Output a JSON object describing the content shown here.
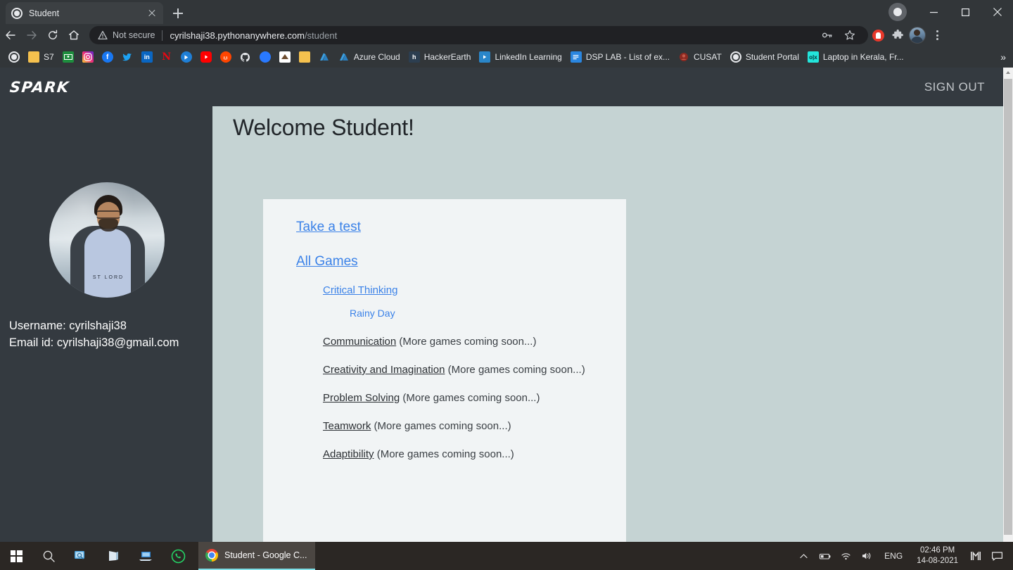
{
  "browser": {
    "tab": {
      "title": "Student",
      "favicon": "globe-icon"
    },
    "new_tab_label": "+",
    "omnibox": {
      "security_label": "Not secure",
      "url_host": "cyrilshaji38.pythonanywhere.com",
      "url_path": "/student"
    },
    "toolbar_icons": [
      "back-icon",
      "forward-icon",
      "reload-icon",
      "home-icon",
      "key-icon",
      "star-icon",
      "adblock-shield-icon",
      "extensions-puzzle-icon",
      "profile-avatar-icon",
      "three-dot-menu-icon"
    ],
    "window_controls": [
      "record-indicator",
      "minimize",
      "maximize",
      "close"
    ],
    "bookmarks": [
      {
        "label": "",
        "icon": "globe-icon"
      },
      {
        "label": "S7",
        "icon": "folder-icon"
      },
      {
        "label": "",
        "icon": "google-classroom-icon"
      },
      {
        "label": "",
        "icon": "instagram-icon"
      },
      {
        "label": "",
        "icon": "facebook-icon"
      },
      {
        "label": "",
        "icon": "twitter-icon"
      },
      {
        "label": "",
        "icon": "linkedin-icon"
      },
      {
        "label": "",
        "icon": "netflix-icon"
      },
      {
        "label": "",
        "icon": "video-icon"
      },
      {
        "label": "",
        "icon": "youtube-icon"
      },
      {
        "label": "",
        "icon": "reddit-icon"
      },
      {
        "label": "",
        "icon": "github-icon"
      },
      {
        "label": "",
        "icon": "blue-circle-icon"
      },
      {
        "label": "",
        "icon": "book-icon"
      },
      {
        "label": "",
        "icon": "folder-icon"
      },
      {
        "label": "",
        "icon": "azure-icon"
      },
      {
        "label": "Azure Cloud",
        "icon": "azure-icon"
      },
      {
        "label": "HackerEarth",
        "icon": "hackerearth-icon"
      },
      {
        "label": "LinkedIn Learning",
        "icon": "linkedin-learning-icon"
      },
      {
        "label": "DSP LAB - List of ex...",
        "icon": "document-icon"
      },
      {
        "label": "CUSAT",
        "icon": "cusat-icon"
      },
      {
        "label": "Student Portal",
        "icon": "globe-icon"
      },
      {
        "label": "Laptop in Kerala, Fr...",
        "icon": "olx-icon"
      }
    ],
    "overflow_label": "»"
  },
  "app": {
    "brand": "SPARK",
    "sign_out_label": "SIGN OUT"
  },
  "sidebar": {
    "avatar_alt": "student-profile-photo",
    "avatar_shirt_text": "ST LORD",
    "username_line": "Username: cyrilshaji38",
    "email_line": "Email id: cyrilshaji38@gmail.com"
  },
  "main": {
    "heading": "Welcome Student!",
    "take_test_link": "Take a test",
    "all_games_link": "All Games",
    "critical_thinking_link": "Critical Thinking",
    "rainy_day_link": "Rainy Day",
    "categories": [
      {
        "name": "Communication",
        "note": "(More games coming soon...)"
      },
      {
        "name": "Creativity and Imagination",
        "note": "(More games coming soon...)"
      },
      {
        "name": "Problem Solving",
        "note": "(More games coming soon...)"
      },
      {
        "name": "Teamwork",
        "note": "(More games coming soon...)"
      },
      {
        "name": "Adaptibility",
        "note": "(More games coming soon...)"
      }
    ]
  },
  "taskbar": {
    "start_label": "start-button",
    "items": [
      "search-icon",
      "task-view-icon",
      "store-icon",
      "remote-desktop-icon",
      "whatsapp-icon"
    ],
    "active_window": "Student - Google C...",
    "tray": {
      "expand_label": "^",
      "battery": "battery-icon",
      "wifi": "wifi-icon",
      "volume": "volume-icon",
      "language": "ENG",
      "time": "02:46 PM",
      "date": "14-08-2021",
      "extra_icon": "mi-icon",
      "action_center": "action-center-icon"
    }
  },
  "colors": {
    "page_bg": "#c5d3d3",
    "card_bg": "#f1f4f5",
    "navbar_bg": "#343a40",
    "link_blue": "#3b82e8",
    "chrome_bg": "#323639"
  }
}
